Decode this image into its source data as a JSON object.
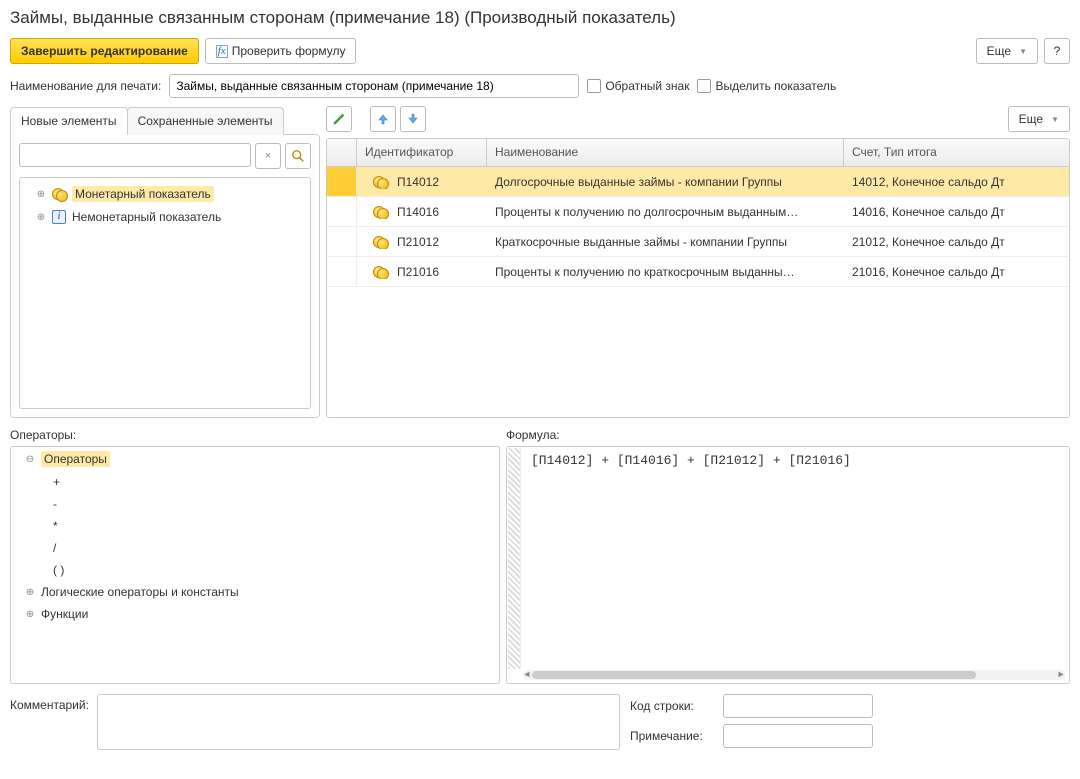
{
  "title": "Займы, выданные связанным сторонам (примечание 18) (Производный показатель)",
  "toolbar": {
    "finish": "Завершить редактирование",
    "check_formula": "Проверить формулу",
    "more": "Еще",
    "help": "?"
  },
  "print_name": {
    "label": "Наименование для печати:",
    "value": "Займы, выданные связанным сторонам (примечание 18)"
  },
  "checkboxes": {
    "reverse_sign": "Обратный знак",
    "highlight_indicator": "Выделить показатель"
  },
  "tabs": {
    "new": "Новые элементы",
    "saved": "Сохраненные элементы"
  },
  "left_tree": {
    "monetary": "Монетарный показатель",
    "nonmonetary": "Немонетарный показатель"
  },
  "grid": {
    "headers": {
      "id": "Идентификатор",
      "name": "Наименование",
      "acc": "Счет, Тип итога"
    },
    "rows": [
      {
        "id": "П14012",
        "name": "Долгосрочные выданные займы -  компании Группы",
        "acc": "14012, Конечное сальдо Дт",
        "selected": true
      },
      {
        "id": "П14016",
        "name": "Проценты к получению по долгосрочным выданным…",
        "acc": "14016, Конечное сальдо Дт",
        "selected": false
      },
      {
        "id": "П21012",
        "name": "Краткосрочные выданные займы -  компании Группы",
        "acc": "21012, Конечное сальдо Дт",
        "selected": false
      },
      {
        "id": "П21016",
        "name": "Проценты к получению по краткосрочным выданны…",
        "acc": "21016, Конечное сальдо Дт",
        "selected": false
      }
    ]
  },
  "operators": {
    "label": "Операторы:",
    "root": "Операторы",
    "items": [
      "+",
      "-",
      "*",
      "/",
      "( )"
    ],
    "logical": "Логические операторы и константы",
    "functions": "Функции"
  },
  "formula": {
    "label": "Формула:",
    "text": "[П14012] + [П14016] + [П21012] + [П21016]"
  },
  "bottom": {
    "comment_label": "Комментарий:",
    "row_code_label": "Код строки:",
    "note_label": "Примечание:",
    "row_code_value": "",
    "note_value": "",
    "comment_value": ""
  },
  "right_toolbar_more": "Еще"
}
